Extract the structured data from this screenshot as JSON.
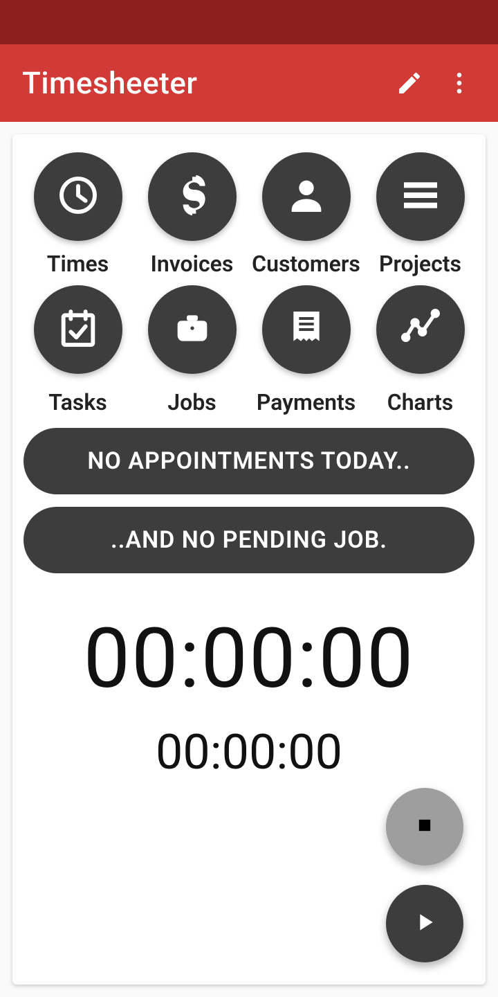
{
  "header": {
    "title": "Timesheeter"
  },
  "grid": {
    "items": [
      {
        "label": "Times",
        "icon": "clock-icon"
      },
      {
        "label": "Invoices",
        "icon": "dollar-icon"
      },
      {
        "label": "Customers",
        "icon": "person-icon"
      },
      {
        "label": "Projects",
        "icon": "list-icon"
      },
      {
        "label": "Tasks",
        "icon": "calendar-check-icon"
      },
      {
        "label": "Jobs",
        "icon": "briefcase-icon"
      },
      {
        "label": "Payments",
        "icon": "receipt-icon"
      },
      {
        "label": "Charts",
        "icon": "chart-line-icon"
      }
    ]
  },
  "status": {
    "appointments": "NO APPOINTMENTS TODAY..",
    "pending_job": "..AND NO PENDING JOB."
  },
  "timer": {
    "large": "00:00:00",
    "small": "00:00:00"
  }
}
